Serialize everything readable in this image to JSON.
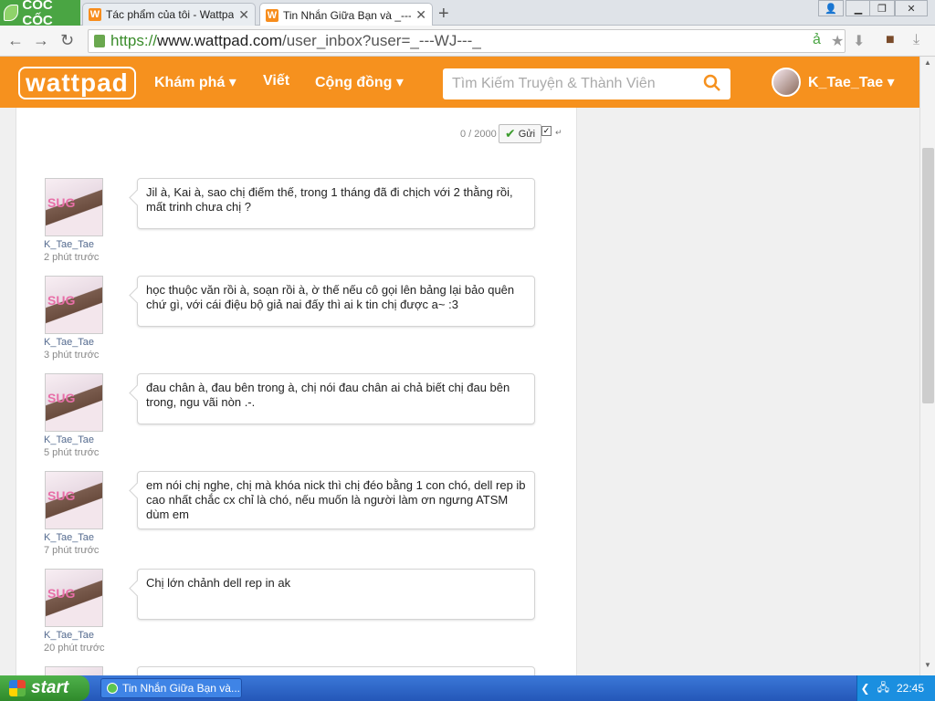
{
  "browser": {
    "brand": "CỐC CỐC",
    "tabs": [
      {
        "label": "Tác phẩm của tôi - Wattpad",
        "active": false
      },
      {
        "label": "Tin Nhắn Giữa Bạn và _---WJ",
        "active": true
      }
    ],
    "url": {
      "scheme": "https://",
      "host": "www.wattpad.com",
      "path": "/user_inbox?user=_---WJ---_"
    }
  },
  "header": {
    "logo": "wattpad",
    "nav": [
      "Khám phá ▾",
      "Viết",
      "Cộng đồng ▾"
    ],
    "search_placeholder": "Tìm Kiếm Truyện & Thành Viên",
    "username": "K_Tae_Tae ▾"
  },
  "composer": {
    "counter": "0 / 2000",
    "send_label": "Gửi",
    "enter_symbol": "↵"
  },
  "messages": [
    {
      "user": "K_Tae_Tae",
      "time": "2 phút trước",
      "text": "Jil à, Kai à, sao chị điếm thế, trong 1 tháng đã đi chịch với 2 thằng rồi, mất trinh chưa chị ?"
    },
    {
      "user": "K_Tae_Tae",
      "time": "3 phút trước",
      "text": "học thuộc văn rồi à, soạn rồi à, ờ thế nếu cô gọi lên bảng lại bảo quên chứ gì, với cái điệu bộ giả nai đấy thì ai k tin chị được a~ :3"
    },
    {
      "user": "K_Tae_Tae",
      "time": "5 phút trước",
      "text": "đau chân à, đau bên trong à, chị nói đau chân ai chả biết chị đau bên trong, ngu vãi nòn .-."
    },
    {
      "user": "K_Tae_Tae",
      "time": "7 phút trước",
      "text": "em nói chị nghe, chị mà khóa nick thì chị đéo bằng 1 con chó, dell rep ib cao nhất chắc cx chỉ là chó, nếu muốn là người làm ơn ngưng ATSM dùm em"
    },
    {
      "user": "K_Tae_Tae",
      "time": "20 phút trước",
      "text": "Chị lớn chảnh dell rep in ak"
    }
  ],
  "taskbar": {
    "start_label": "start",
    "window_label": "Tin Nhắn Giữa Bạn và...",
    "clock": "22:45"
  },
  "colors": {
    "wattpad_orange": "#f6911e",
    "coccoc_green": "#4aa543"
  }
}
